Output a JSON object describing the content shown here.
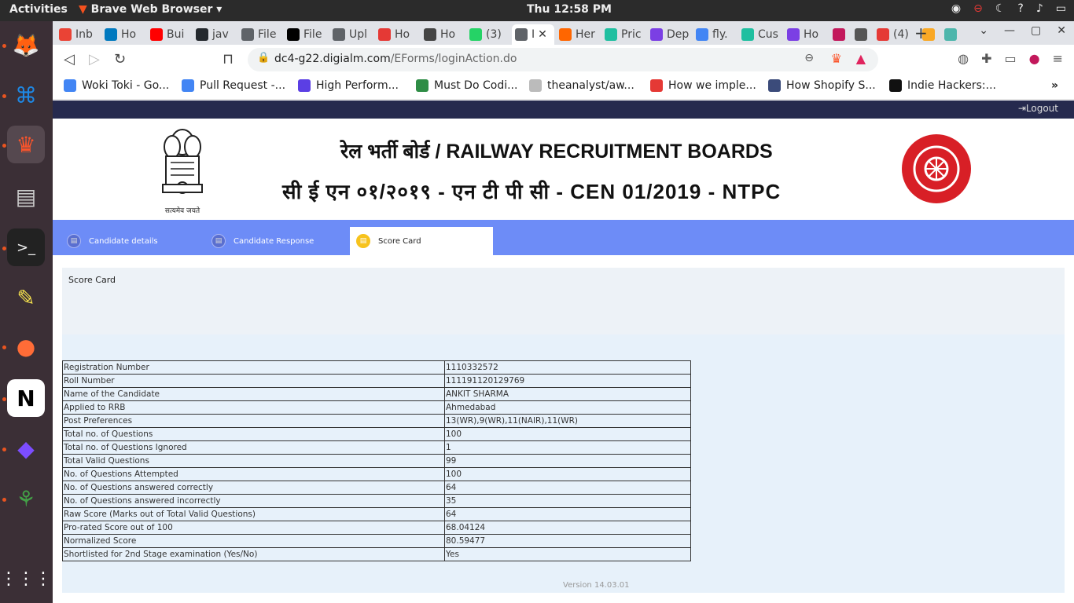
{
  "topbar": {
    "activities": "Activities",
    "app_name": "Brave Web Browser",
    "clock": "Thu 12:58 PM"
  },
  "browser": {
    "tabs": [
      {
        "label": "Inb",
        "icon": "gmail-icon",
        "color": "#ea4335"
      },
      {
        "label": "Ho",
        "icon": "trello-icon",
        "color": "#0079bf"
      },
      {
        "label": "Bui",
        "icon": "youtube-icon",
        "color": "#ff0000"
      },
      {
        "label": "jav",
        "icon": "github-icon",
        "color": "#24292e"
      },
      {
        "label": "File",
        "icon": "globe-icon",
        "color": "#5f6368"
      },
      {
        "label": "File",
        "icon": "fileformat-icon",
        "color": "#000000"
      },
      {
        "label": "Upl",
        "icon": "globe-icon",
        "color": "#5f6368"
      },
      {
        "label": "Ho",
        "icon": "s-logo-icon",
        "color": "#e53935"
      },
      {
        "label": "Ho",
        "icon": "anchor-icon",
        "color": "#444444"
      },
      {
        "label": "(3)",
        "icon": "whatsapp-icon",
        "color": "#25d366"
      },
      {
        "label": "I",
        "icon": "globe-icon",
        "color": "#5f6368",
        "active": true
      },
      {
        "label": "Her",
        "icon": "ycombinator-icon",
        "color": "#ff6600"
      },
      {
        "label": "Pric",
        "icon": "dotted-square-icon",
        "color": "#1fbfa0"
      },
      {
        "label": "Dep",
        "icon": "heroku-icon",
        "color": "#7b3fe4"
      },
      {
        "label": "fly.",
        "icon": "google-icon",
        "color": "#4285f4"
      },
      {
        "label": "Cus",
        "icon": "dotted-square-icon",
        "color": "#1fbfa0"
      },
      {
        "label": "Ho",
        "icon": "heroku-icon",
        "color": "#7b3fe4"
      },
      {
        "label": "",
        "icon": "colorful-circle-icon",
        "color": "#c2185b"
      },
      {
        "label": "",
        "icon": "tools-icon",
        "color": "#555555"
      },
      {
        "label": "(4)",
        "icon": "scissors-icon",
        "color": "#e53935"
      },
      {
        "label": "",
        "icon": "orange-badge-icon",
        "color": "#f9a825"
      },
      {
        "label": "",
        "icon": "avatar-icon",
        "color": "#4db6ac"
      }
    ],
    "url_domain": "dc4-g22.digialm.com",
    "url_path": "/EForms/loginAction.do",
    "bookmarks": [
      {
        "label": "Woki Toki - Go...",
        "icon": "docs-icon",
        "color": "#4285f4"
      },
      {
        "label": "Pull Request -...",
        "icon": "docs-icon",
        "color": "#4285f4"
      },
      {
        "label": "High Perform...",
        "icon": "diamond-icon",
        "color": "#5b3fe4"
      },
      {
        "label": "Must Do Codi...",
        "icon": "gfg-icon",
        "color": "#2f8d46"
      },
      {
        "label": "theanalyst/aw...",
        "icon": "github-icon",
        "color": "#bbbbbb"
      },
      {
        "label": "How we imple...",
        "icon": "triangle-icon",
        "color": "#e53935"
      },
      {
        "label": "How Shopify S...",
        "icon": "shopify-icon",
        "color": "#3b4b7a"
      },
      {
        "label": "Indie Hackers:...",
        "icon": "ih-icon",
        "color": "#111111"
      }
    ]
  },
  "page": {
    "logout": "Logout",
    "header_line1": "रेल भर्ती बोर्ड / RAILWAY RECRUITMENT BOARDS",
    "header_line2": "सी ई एन ०१/२०१९ - एन टी पी सी - CEN 01/2019 - NTPC",
    "emblem_motto": "सत्यमेव जयते",
    "tabs": [
      {
        "label": "Candidate details"
      },
      {
        "label": "Candidate Response"
      },
      {
        "label": "Score Card",
        "active": true
      }
    ],
    "scorecard_title": "Score Card",
    "rows": [
      {
        "key": "Registration Number",
        "value": "1110332572"
      },
      {
        "key": "Roll Number",
        "value": "111191120129769"
      },
      {
        "key": "Name of the Candidate",
        "value": "ANKIT SHARMA"
      },
      {
        "key": "Applied to RRB",
        "value": "Ahmedabad"
      },
      {
        "key": "Post Preferences",
        "value": "13(WR),9(WR),11(NAIR),11(WR)"
      },
      {
        "key": "Total no. of Questions",
        "value": "100"
      },
      {
        "key": "Total no. of Questions Ignored",
        "value": "1"
      },
      {
        "key": "Total Valid Questions",
        "value": "99"
      },
      {
        "key": "No. of Questions Attempted",
        "value": "100"
      },
      {
        "key": "No. of Questions answered correctly",
        "value": "64"
      },
      {
        "key": "No. of Questions answered incorrectly",
        "value": "35"
      },
      {
        "key": "Raw Score (Marks out of Total Valid Questions)",
        "value": "64"
      },
      {
        "key": "Pro-rated Score out of 100",
        "value": "68.04124"
      },
      {
        "key": "Normalized Score",
        "value": "80.59477"
      },
      {
        "key": "Shortlisted for 2nd Stage examination (Yes/No)",
        "value": "Yes"
      }
    ],
    "version": "Version 14.03.01"
  }
}
